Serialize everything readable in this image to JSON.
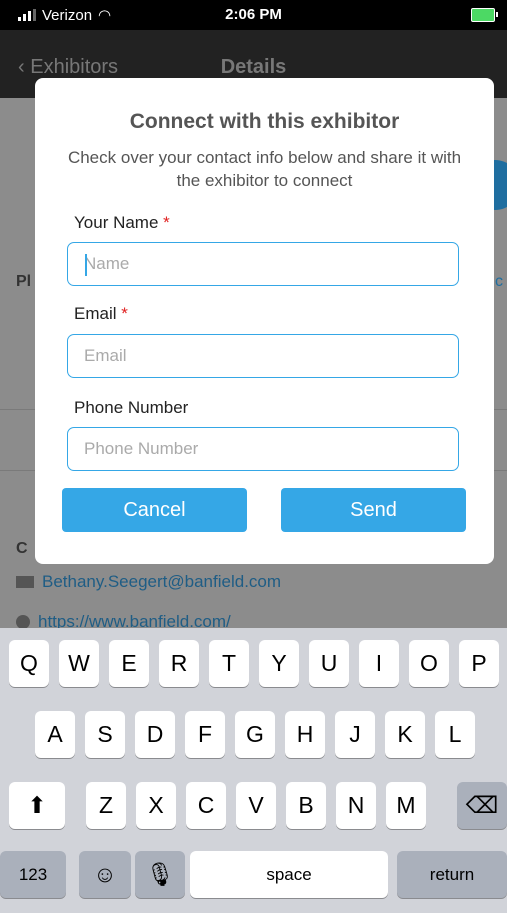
{
  "status_bar": {
    "carrier": "Verizon",
    "time": "2:06 PM"
  },
  "nav": {
    "back_label": "Exhibitors",
    "title": "Details"
  },
  "background": {
    "section_label_1": "Pl",
    "section_label_2": "C",
    "right_fragment": "c",
    "email": "Bethany.Seegert@banfield.com",
    "website": "https://www.banfield.com/"
  },
  "modal": {
    "title": "Connect with this exhibitor",
    "subtitle": "Check over your contact info below and share it with the exhibitor to connect",
    "name_label": "Your Name",
    "name_placeholder": "Name",
    "email_label": "Email",
    "email_placeholder": "Email",
    "phone_label": "Phone Number",
    "phone_placeholder": "Phone Number",
    "required_mark": "*",
    "cancel_label": "Cancel",
    "send_label": "Send"
  },
  "keyboard": {
    "row1": [
      "Q",
      "W",
      "E",
      "R",
      "T",
      "Y",
      "U",
      "I",
      "O",
      "P"
    ],
    "row2": [
      "A",
      "S",
      "D",
      "F",
      "G",
      "H",
      "J",
      "K",
      "L"
    ],
    "row3": [
      "Z",
      "X",
      "C",
      "V",
      "B",
      "N",
      "M"
    ],
    "num_label": "123",
    "space_label": "space",
    "return_label": "return"
  }
}
